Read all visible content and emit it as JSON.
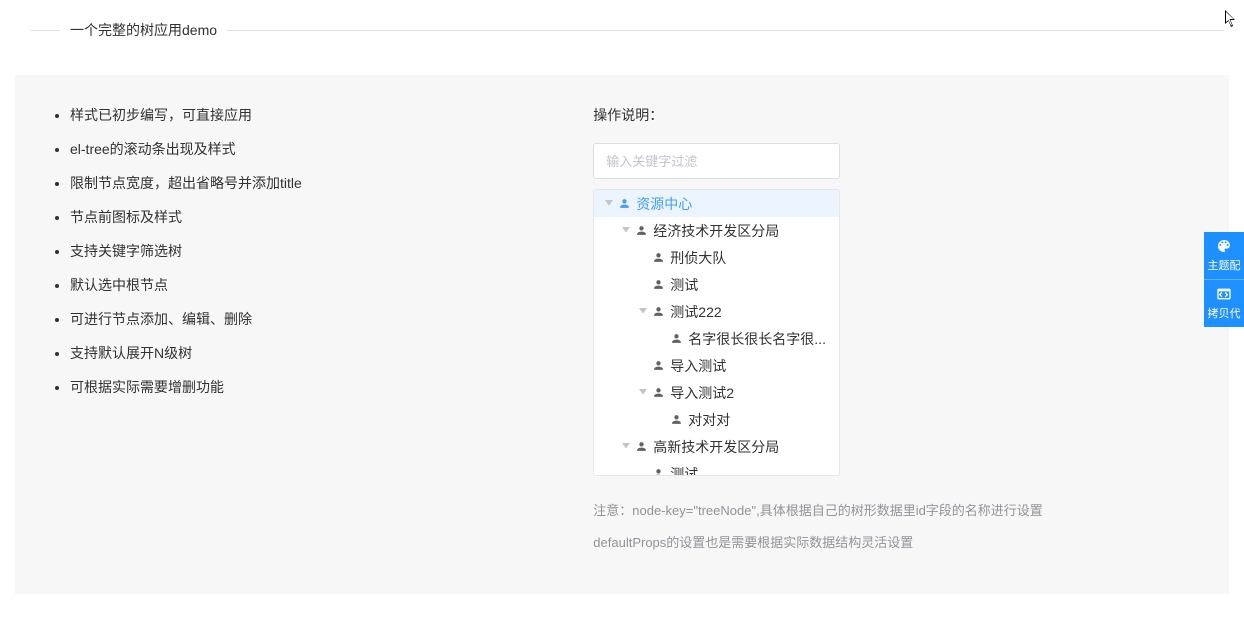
{
  "divider": {
    "title": "一个完整的树应用demo"
  },
  "features": [
    "样式已初步编写，可直接应用",
    "el-tree的滚动条出现及样式",
    "限制节点宽度，超出省略号并添加title",
    "节点前图标及样式",
    "支持关键字筛选树",
    "默认选中根节点",
    "可进行节点添加、编辑、删除",
    "支持默认展开N级树",
    "可根据实际需要增删功能"
  ],
  "operation": {
    "title": "操作说明：",
    "filter_placeholder": "输入关键字过滤"
  },
  "tree": {
    "nodes": [
      {
        "level": 0,
        "expandable": true,
        "label": "资源中心",
        "selected": true
      },
      {
        "level": 1,
        "expandable": true,
        "label": "经济技术开发区分局",
        "selected": false
      },
      {
        "level": 2,
        "expandable": false,
        "label": "刑侦大队",
        "selected": false
      },
      {
        "level": 2,
        "expandable": false,
        "label": "测试",
        "selected": false
      },
      {
        "level": 2,
        "expandable": true,
        "label": "测试222",
        "selected": false
      },
      {
        "level": 3,
        "expandable": false,
        "label": "名字很长很长名字很...",
        "selected": false
      },
      {
        "level": 2,
        "expandable": false,
        "label": "导入测试",
        "selected": false
      },
      {
        "level": 2,
        "expandable": true,
        "label": "导入测试2",
        "selected": false
      },
      {
        "level": 3,
        "expandable": false,
        "label": "对对对",
        "selected": false
      },
      {
        "level": 1,
        "expandable": true,
        "label": "高新技术开发区分局",
        "selected": false
      },
      {
        "level": 2,
        "expandable": false,
        "label": "测试",
        "selected": false
      }
    ]
  },
  "notes": {
    "line1": "注意：node-key=\"treeNode\",具体根据自己的树形数据里id字段的名称进行设置",
    "line2": "defaultProps的设置也是需要根据实际数据结构灵活设置"
  },
  "sideTabs": {
    "theme": "主题配",
    "copy": "拷贝代"
  }
}
